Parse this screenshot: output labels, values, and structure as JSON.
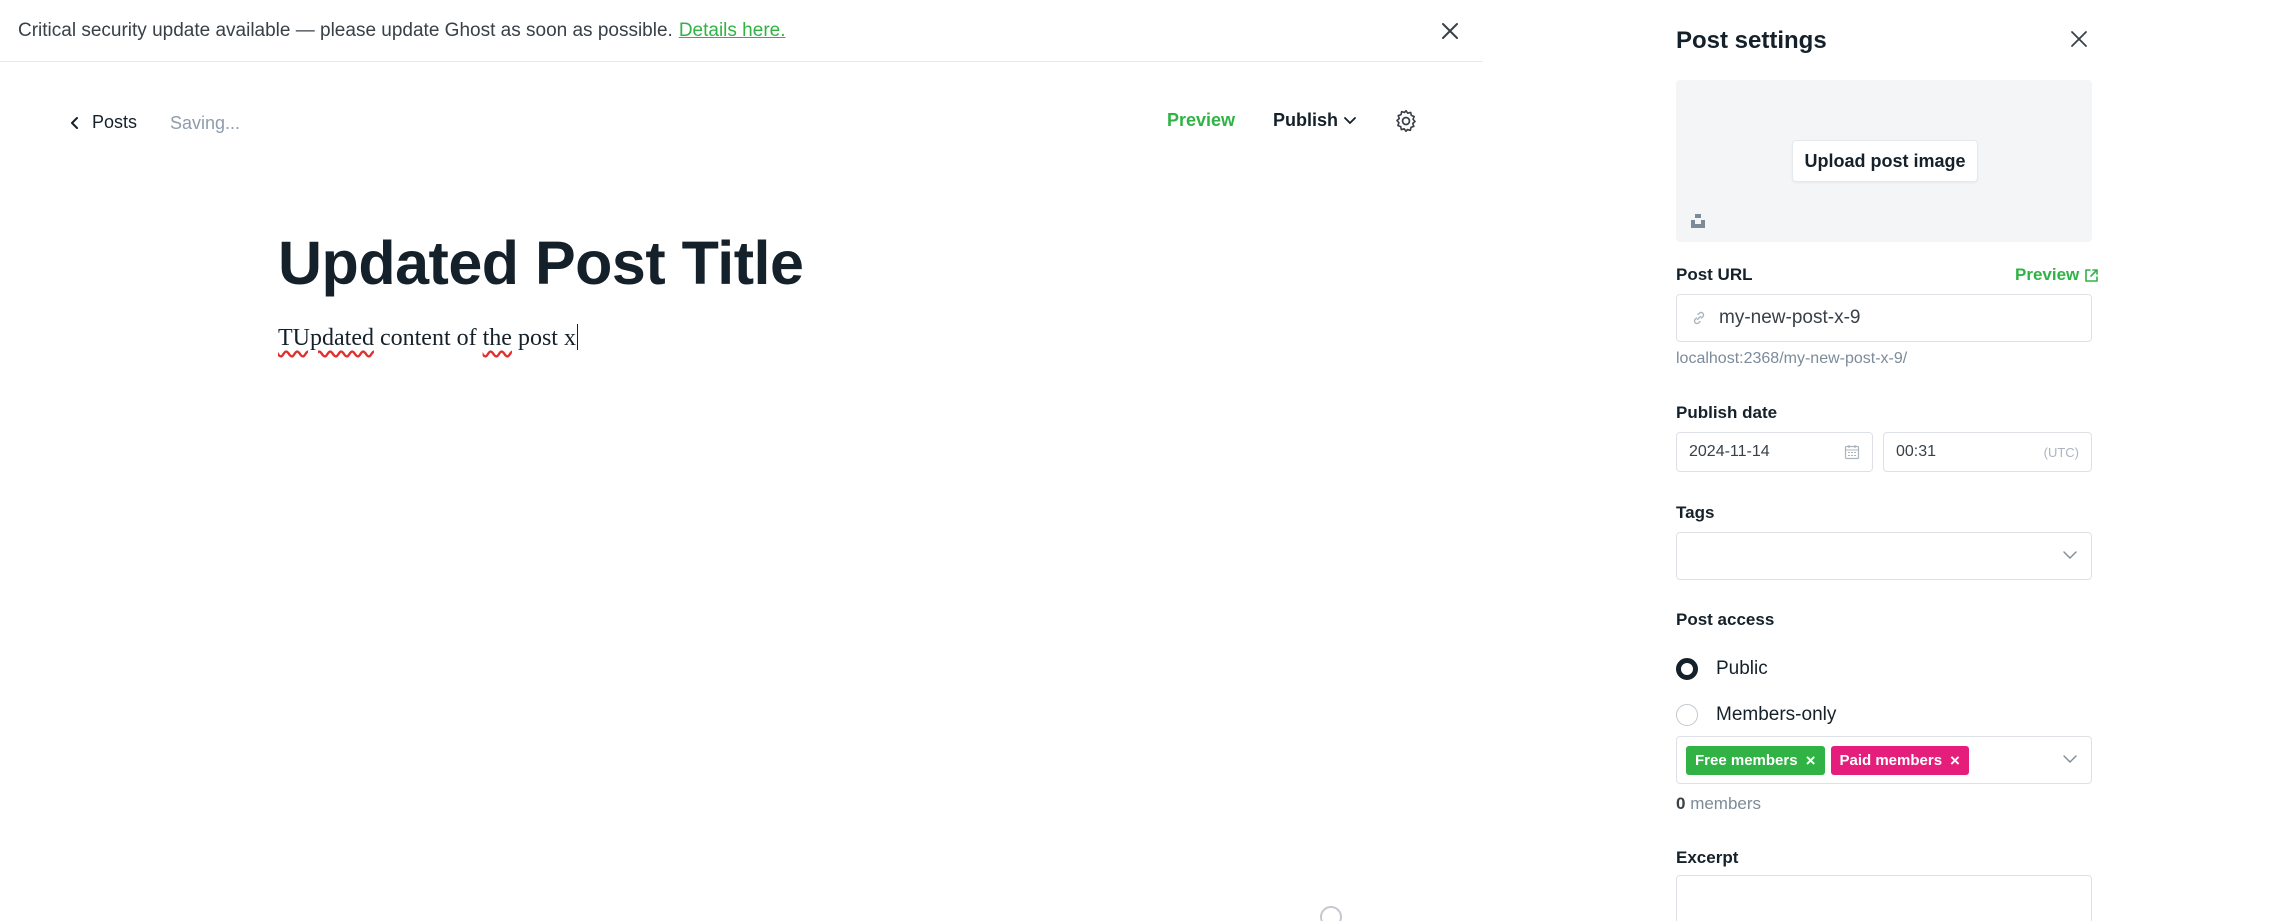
{
  "banner": {
    "message": "Critical security update available — please update Ghost as soon as possible.",
    "link_text": "Details here."
  },
  "toolbar": {
    "back_label": "Posts",
    "status": "Saving...",
    "preview_label": "Preview",
    "publish_label": "Publish"
  },
  "editor": {
    "title": "Updated Post Title",
    "content_misspelled": "TUpdated",
    "content_rest_1": " content of ",
    "content_misspelled_2": "the",
    "content_rest_2": " post x"
  },
  "settings": {
    "title": "Post settings",
    "upload_label": "Upload post image",
    "url_label": "Post URL",
    "url_preview_label": "Preview",
    "url_value": "my-new-post-x-9",
    "url_full": "localhost:2368/my-new-post-x-9/",
    "publish_date_label": "Publish date",
    "date_value": "2024-11-14",
    "time_value": "00:31",
    "timezone": "(UTC)",
    "tags_label": "Tags",
    "access_label": "Post access",
    "access_public": "Public",
    "access_members": "Members-only",
    "tiers": [
      {
        "label": "Free members",
        "color": "#30b344"
      },
      {
        "label": "Paid members",
        "color": "#e61e7b"
      }
    ],
    "members_count": "0",
    "members_suffix": " members",
    "excerpt_label": "Excerpt"
  },
  "colors": {
    "accent_green": "#2fb344",
    "text_dark": "#15212a",
    "muted": "#8e9cac"
  }
}
